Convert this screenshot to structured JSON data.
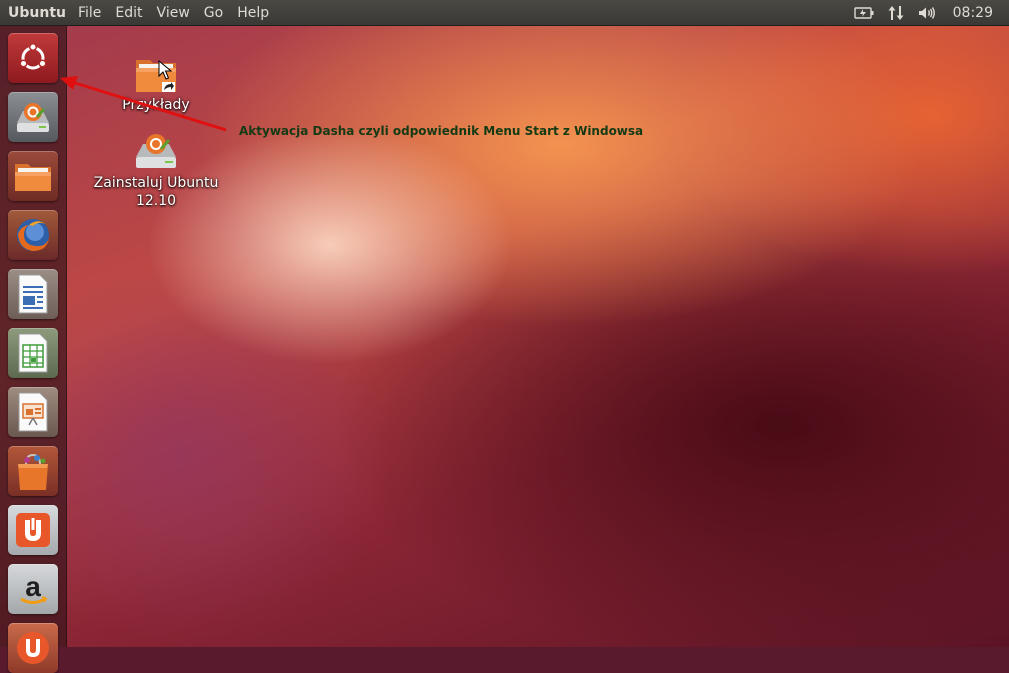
{
  "top_panel": {
    "app_name": "Ubuntu",
    "menus": [
      "File",
      "Edit",
      "View",
      "Go",
      "Help"
    ],
    "indicators": [
      "battery-icon",
      "network-icon",
      "volume-icon"
    ],
    "clock": "08:29",
    "colors": {
      "panel": "#3c3b37",
      "text": "#dfdbd2"
    }
  },
  "launcher": {
    "items": [
      {
        "name": "dash-home-icon",
        "tooltip": ""
      },
      {
        "name": "install-ubuntu-icon",
        "tooltip": ""
      },
      {
        "name": "files-folder-icon",
        "tooltip": ""
      },
      {
        "name": "firefox-icon",
        "tooltip": ""
      },
      {
        "name": "libreoffice-writer-icon",
        "tooltip": ""
      },
      {
        "name": "libreoffice-calc-icon",
        "tooltip": ""
      },
      {
        "name": "libreoffice-impress-icon",
        "tooltip": ""
      },
      {
        "name": "ubuntu-software-center-icon",
        "tooltip": ""
      },
      {
        "name": "ubuntu-one-icon",
        "tooltip": ""
      },
      {
        "name": "amazon-icon",
        "tooltip": ""
      },
      {
        "name": "ubuntu-one-music-icon",
        "tooltip": ""
      }
    ]
  },
  "desktop": {
    "icons": [
      {
        "label": "Przykłady"
      },
      {
        "label": "Zainstaluj Ubuntu 12.10"
      }
    ]
  },
  "annotation": {
    "text": "Aktywacja Dasha czyli odpowiednik Menu Start z Windowsa",
    "color": "#143a14",
    "arrow_color": "#e01010"
  }
}
